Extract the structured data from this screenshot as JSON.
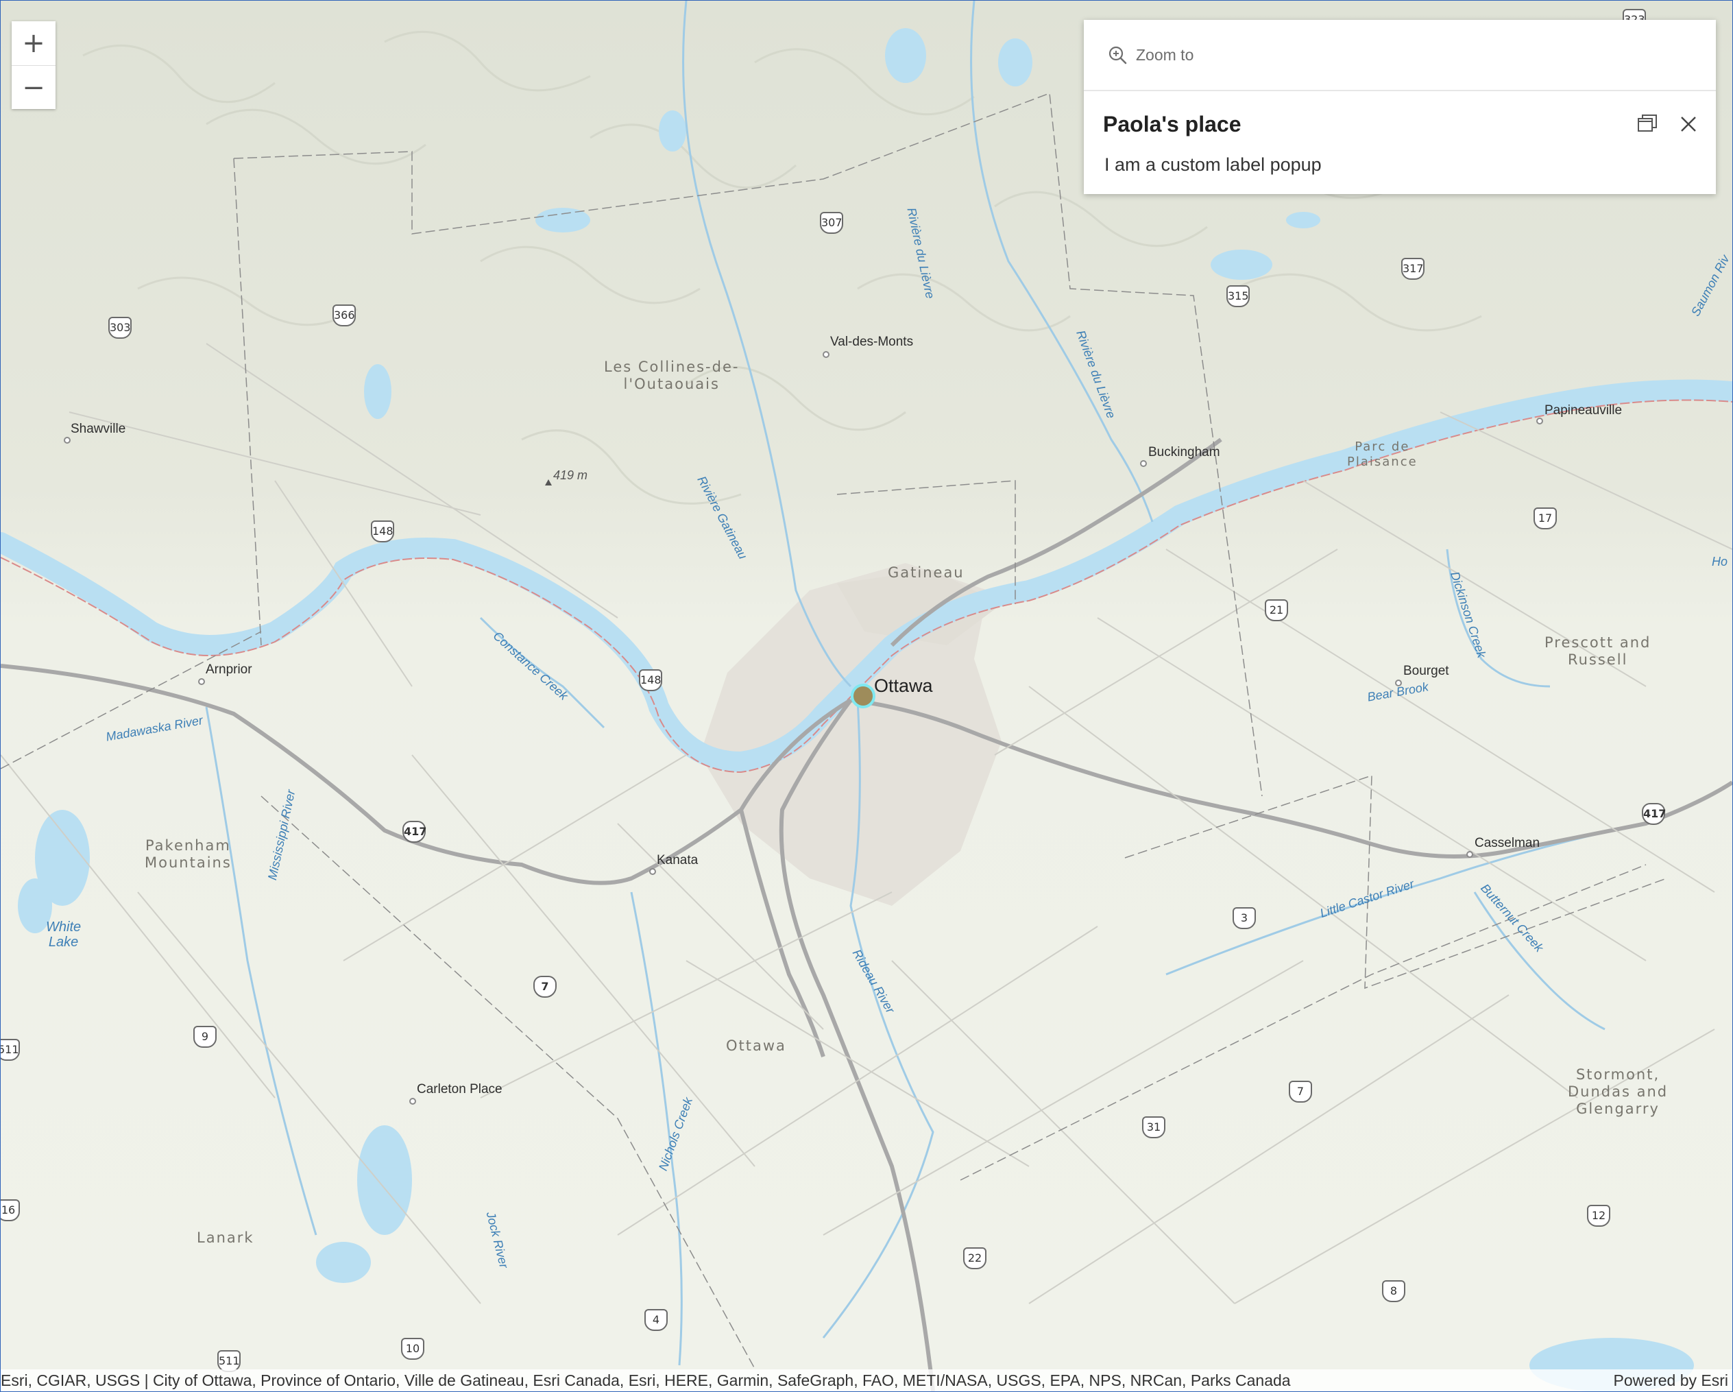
{
  "zoom": {
    "in_label": "+",
    "out_label": "−"
  },
  "popup": {
    "action_label": "Zoom to",
    "title": "Paola's place",
    "body": "I am a custom label popup",
    "dock_icon": "dock-icon",
    "close_icon": "close-icon"
  },
  "map": {
    "major_city": "Ottawa",
    "places": {
      "val_des_monts": "Val-des-Monts",
      "shawville": "Shawville",
      "buckingham": "Buckingham",
      "papineauville": "Papineauville",
      "arnprior": "Arnprior",
      "bourget": "Bourget",
      "kanata": "Kanata",
      "casselman": "Casselman",
      "carleton_place": "Carleton Place"
    },
    "regions": {
      "collines": "Les Collines-de-\nl'Outaouais",
      "gatineau": "Gatineau",
      "prescott": "Prescott and\nRussell",
      "pakenham": "Pakenham\nMountains",
      "ottawa_region": "Ottawa",
      "stormont": "Stormont,\nDundas and\nGlengarry",
      "lanark": "Lanark"
    },
    "parc": "Parc de\nPlaisance",
    "peak": "419 m",
    "water": {
      "riviere_du_lievre_1": "Rivière du Lièvre",
      "riviere_du_lievre_2": "Rivière du Lièvre",
      "riviere_gatineau": "Rivière Gatineau",
      "constance_creek": "Constance Creek",
      "madawaska": "Madawaska River",
      "mississippi": "Mississippi River",
      "white_lake": "White\nLake",
      "rideau": "Rideau River",
      "nichols": "Nichols Creek",
      "jock": "Jock River",
      "dickinson": "Dickinson Creek",
      "bear_brook": "Bear Brook",
      "little_castor": "Little Castor River",
      "butternut": "Butternut Creek",
      "saumon": "Saumon Riv",
      "edge_ho": "Ho"
    },
    "shields": {
      "r323": "323",
      "r307": "307",
      "r317": "317",
      "r315": "315",
      "r303": "303",
      "r366": "366",
      "r148a": "148",
      "r148b": "148",
      "r17": "17",
      "r21": "21",
      "r417a": "417",
      "r417b": "417",
      "r3": "3",
      "r7a": "7",
      "r7b": "7",
      "r9": "9",
      "r511a": "511",
      "r511b": "511",
      "r31": "31",
      "r16": "16",
      "r22": "22",
      "r12": "12",
      "r8": "8",
      "r4": "4",
      "r10": "10"
    }
  },
  "attribution": {
    "text": "Esri, CGIAR, USGS | City of Ottawa, Province of Ontario, Ville de Gatineau, Esri Canada, Esri, HERE, Garmin, SafeGraph, FAO, METI/NASA, USGS, EPA, NPS, NRCan, Parks Canada",
    "powered": "Powered by Esri"
  }
}
